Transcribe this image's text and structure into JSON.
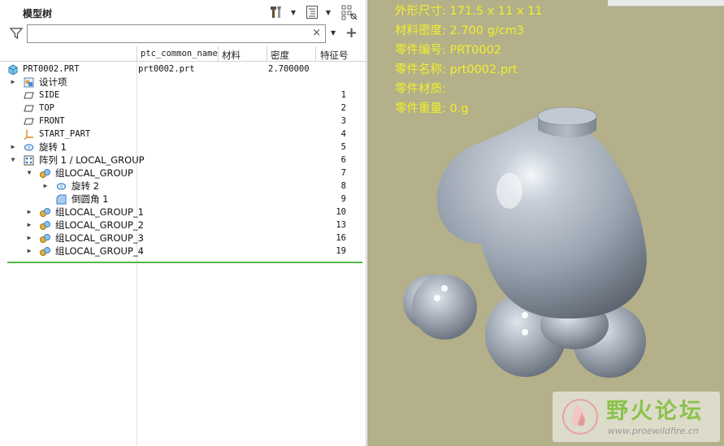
{
  "panel": {
    "title": "模型树",
    "search_value": "",
    "search_clear": "×",
    "add_column": "+"
  },
  "columns": {
    "common_name": "ptc_common_name",
    "material": "材料",
    "density": "密度",
    "feature_id": "特征号"
  },
  "tree": [
    {
      "name": "PRT0002.PRT",
      "common_name": "prt0002.prt",
      "density": "2.700000",
      "feature_id": "",
      "icon": "part-icon",
      "toggle": ""
    },
    {
      "name": "设计项",
      "feature_id": "",
      "icon": "design-items-icon",
      "toggle": "▶"
    },
    {
      "name": "SIDE",
      "feature_id": "1",
      "icon": "datum-plane-icon",
      "toggle": ""
    },
    {
      "name": "TOP",
      "feature_id": "2",
      "icon": "datum-plane-icon",
      "toggle": ""
    },
    {
      "name": "FRONT",
      "feature_id": "3",
      "icon": "datum-plane-icon",
      "toggle": ""
    },
    {
      "name": "START_PART",
      "feature_id": "4",
      "icon": "coordinate-system-icon",
      "toggle": ""
    },
    {
      "name": "旋转 1",
      "feature_id": "5",
      "icon": "revolve-icon",
      "toggle": "▶"
    },
    {
      "name": "阵列 1 / LOCAL_GROUP",
      "feature_id": "6",
      "icon": "pattern-icon",
      "toggle": "▼"
    },
    {
      "name": "组LOCAL_GROUP",
      "feature_id": "7",
      "icon": "group-icon",
      "toggle": "▼"
    },
    {
      "name": "旋转 2",
      "feature_id": "8",
      "icon": "revolve-icon",
      "toggle": "▶"
    },
    {
      "name": "倒圆角 1",
      "feature_id": "9",
      "icon": "round-icon",
      "toggle": ""
    },
    {
      "name": "组LOCAL_GROUP_1",
      "feature_id": "10",
      "icon": "group-icon",
      "toggle": "▶"
    },
    {
      "name": "组LOCAL_GROUP_2",
      "feature_id": "13",
      "icon": "group-icon",
      "toggle": "▶"
    },
    {
      "name": "组LOCAL_GROUP_3",
      "feature_id": "16",
      "icon": "group-icon",
      "toggle": "▶"
    },
    {
      "name": "组LOCAL_GROUP_4",
      "feature_id": "19",
      "icon": "group-icon",
      "toggle": "▶"
    }
  ],
  "model_info": {
    "size": "外形尺寸: 171.5 x 11 x 11",
    "density": "材料密度: 2.700 g/cm3",
    "part_number": "零件编号: PRT0002",
    "part_name": "零件名称: prt0002.prt",
    "material": "零件材质:",
    "weight": "零件重量: 0.g"
  },
  "watermark": {
    "brand": "野火论坛",
    "url": "www.proewildfire.cn"
  },
  "colors": {
    "info_text": "#f1ef2c",
    "viewport_bg": "#b3b08a",
    "insert_line": "#52b948",
    "model_base": "#9aa4b0"
  }
}
